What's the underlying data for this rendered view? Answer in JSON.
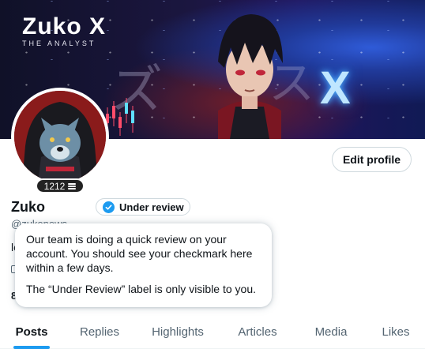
{
  "banner": {
    "brand_name": "Zuko X",
    "brand_subtitle": "THE ANALYST",
    "glyph_left": "ズ",
    "glyph_right": "ス",
    "glyph_x": "X"
  },
  "profile": {
    "followers_badge": "1212",
    "edit_button": "Edit profile",
    "display_name": "Zuko",
    "handle": "@zukonews",
    "bio_fragment": "le",
    "count_fragment": "8"
  },
  "verification": {
    "chip_label": "Under review",
    "tooltip_line1": "Our team is doing a quick review on your account. You should see your checkmark here within a few days.",
    "tooltip_line2": "The “Under Review” label is only visible to you.",
    "check_color": "#1d9bf0"
  },
  "tabs": [
    {
      "label": "Posts",
      "active": true
    },
    {
      "label": "Replies",
      "active": false
    },
    {
      "label": "Highlights",
      "active": false
    },
    {
      "label": "Articles",
      "active": false
    },
    {
      "label": "Media",
      "active": false
    },
    {
      "label": "Likes",
      "active": false
    }
  ],
  "colors": {
    "accent": "#1d9bf0",
    "text": "#0f1419",
    "muted": "#536471"
  }
}
